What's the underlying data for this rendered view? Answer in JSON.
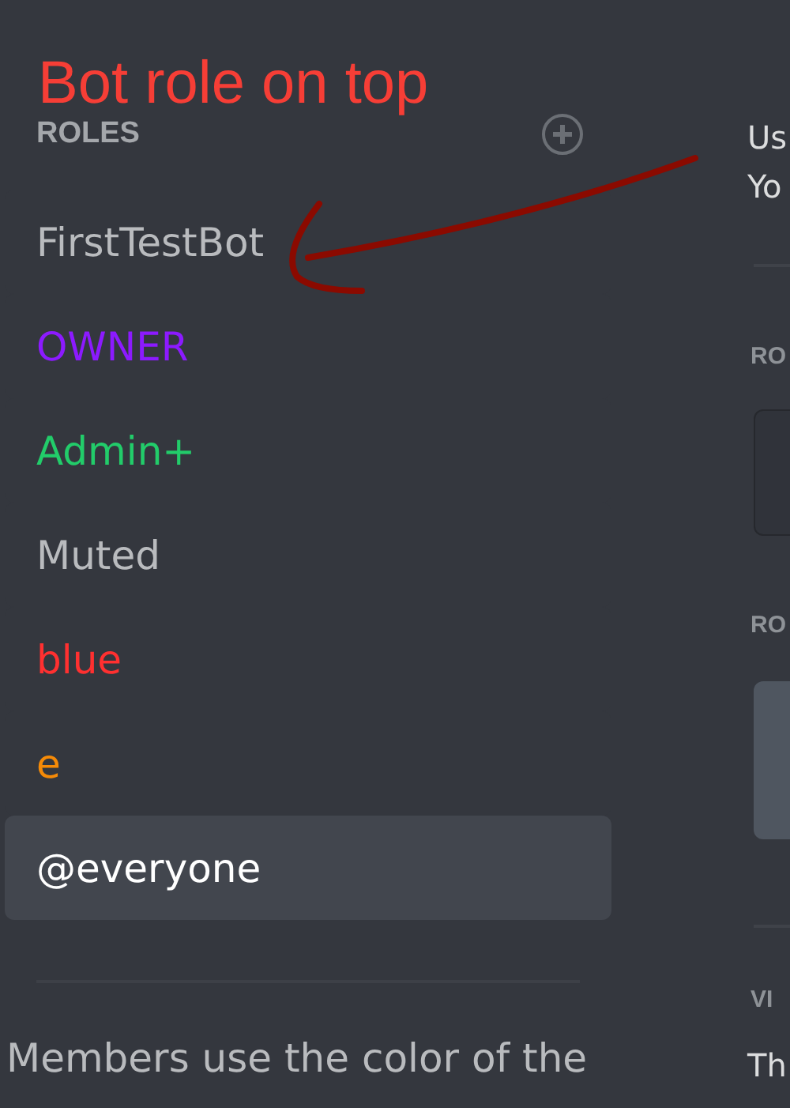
{
  "annotation": {
    "text": "Bot role on top"
  },
  "roles_panel": {
    "title": "ROLES",
    "roles": [
      {
        "name": "FirstTestBot",
        "color": "#b9bbbe",
        "selected": false
      },
      {
        "name": "OWNER",
        "color": "#8c1aff",
        "selected": false
      },
      {
        "name": "Admin+",
        "color": "#22cc6a",
        "selected": false
      },
      {
        "name": "Muted",
        "color": "#b9bbbe",
        "selected": false
      },
      {
        "name": "blue",
        "color": "#ff3030",
        "selected": false
      },
      {
        "name": "e",
        "color": "#f58a07",
        "selected": false
      },
      {
        "name": "@everyone",
        "color": "#ffffff",
        "selected": true
      }
    ],
    "description": "Members use the color of the"
  },
  "right_panel": {
    "intro_lines": [
      "Us",
      "Yo"
    ],
    "section_1": "RO",
    "section_2": "RO",
    "section_3": "VI",
    "text": "Th"
  }
}
